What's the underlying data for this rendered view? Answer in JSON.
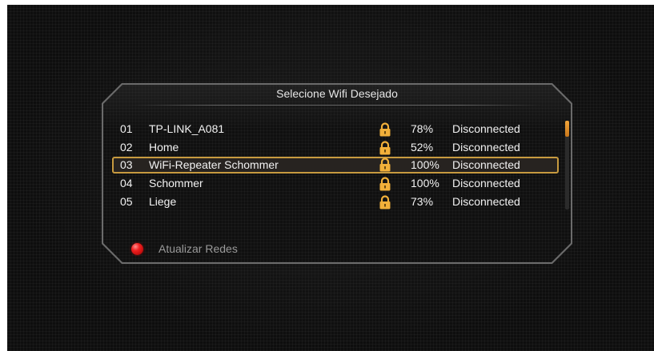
{
  "dialog": {
    "title": "Selecione Wifi Desejado"
  },
  "networks": [
    {
      "num": "01",
      "ssid": "TP-LINK_A081",
      "signal": "78%",
      "status": "Disconnected",
      "icon": "lock-icon"
    },
    {
      "num": "02",
      "ssid": "Home",
      "signal": "52%",
      "status": "Disconnected",
      "icon": "lock-icon"
    },
    {
      "num": "03",
      "ssid": "WiFi-Repeater Schommer",
      "signal": "100%",
      "status": "Disconnected",
      "icon": "lock-icon",
      "selected": true
    },
    {
      "num": "04",
      "ssid": "Schommer",
      "signal": "100%",
      "status": "Disconnected",
      "icon": "lock-icon"
    },
    {
      "num": "05",
      "ssid": "Liege",
      "signal": "73%",
      "status": "Disconnected",
      "icon": "lock-icon"
    }
  ],
  "footer": {
    "button_icon": "red-button-icon",
    "label": "Atualizar Redes"
  },
  "colors": {
    "highlight_border": "#c79a3f",
    "lock": "#f2b03a",
    "scroll_thumb": "#e8932a",
    "red_button": "#e01b1b"
  }
}
